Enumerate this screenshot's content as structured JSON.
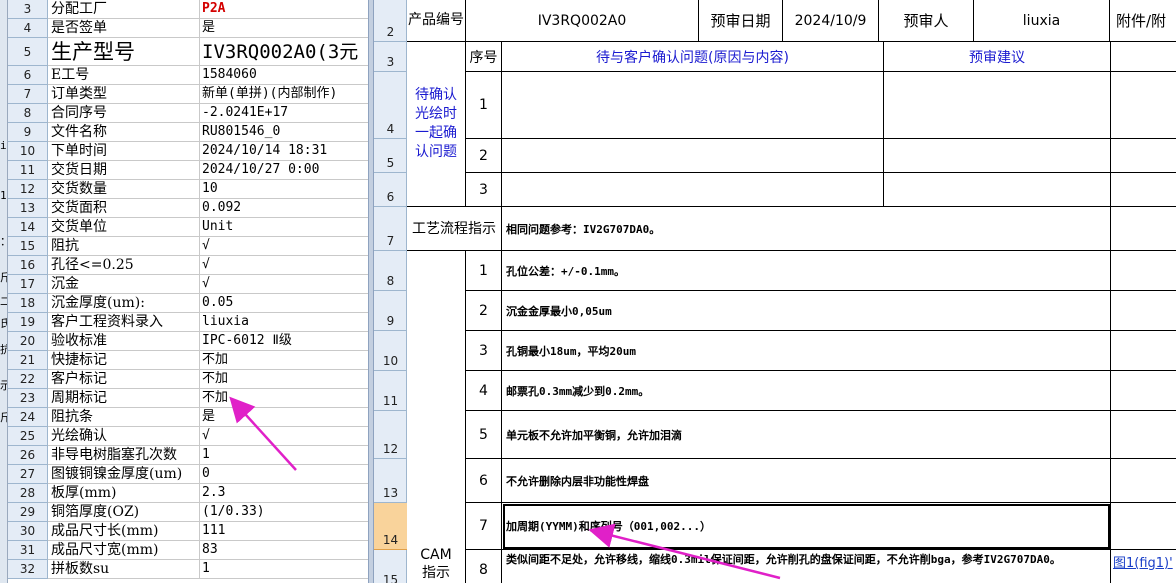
{
  "left_edge_chars": [
    "i",
    "1",
    "：",
    "斤",
    "二",
    "氏",
    "抗",
    "示",
    "斤"
  ],
  "left_sheet": {
    "rows": [
      {
        "num": "3",
        "a": "分配工厂",
        "b": "P2A"
      },
      {
        "num": "4",
        "a": "是否签单",
        "b": "是"
      },
      {
        "num": "5",
        "a": "生产型号",
        "b": "IV3RQ002A0(3元"
      },
      {
        "num": "6",
        "a": "E工号",
        "b": "1584060"
      },
      {
        "num": "7",
        "a": "订单类型",
        "b": "新单(单拼)(内部制作)"
      },
      {
        "num": "8",
        "a": "合同序号",
        "b": "-2.0241E+17"
      },
      {
        "num": "9",
        "a": "文件名称",
        "b": "RU801546_0"
      },
      {
        "num": "10",
        "a": "下单时间",
        "b": "2024/10/14 18:31"
      },
      {
        "num": "11",
        "a": "交货日期",
        "b": "2024/10/27 0:00"
      },
      {
        "num": "12",
        "a": "交货数量",
        "b": "10"
      },
      {
        "num": "13",
        "a": "交货面积",
        "b": "0.092"
      },
      {
        "num": "14",
        "a": "交货单位",
        "b": "Unit"
      },
      {
        "num": "15",
        "a": "阻抗",
        "b": "√"
      },
      {
        "num": "16",
        "a": "孔径<=0.25",
        "b": "√"
      },
      {
        "num": "17",
        "a": "沉金",
        "b": "√"
      },
      {
        "num": "18",
        "a": "沉金厚度(um):",
        "b": "0.05"
      },
      {
        "num": "19",
        "a": "客户工程资料录入",
        "b": "liuxia"
      },
      {
        "num": "20",
        "a": "验收标准",
        "b": "IPC-6012 Ⅱ级"
      },
      {
        "num": "21",
        "a": "快捷标记",
        "b": "不加"
      },
      {
        "num": "22",
        "a": "客户标记",
        "b": "不加"
      },
      {
        "num": "23",
        "a": "周期标记",
        "b": "不加"
      },
      {
        "num": "24",
        "a": "阻抗条",
        "b": "是"
      },
      {
        "num": "25",
        "a": "光绘确认",
        "b": "√"
      },
      {
        "num": "26",
        "a": "非导电树脂塞孔次数",
        "b": "1"
      },
      {
        "num": "27",
        "a": "图镀铜镍金厚度(um)",
        "b": "0"
      },
      {
        "num": "28",
        "a": "板厚(mm)",
        "b": "2.3"
      },
      {
        "num": "29",
        "a": "铜箔厚度(OZ)",
        "b": "(1/0.33)"
      },
      {
        "num": "30",
        "a": "成品尺寸长(mm)",
        "b": "111"
      },
      {
        "num": "31",
        "a": "成品尺寸宽(mm)",
        "b": "83"
      },
      {
        "num": "32",
        "a": "拼板数su",
        "b": "1"
      }
    ]
  },
  "right_row_headers": [
    "2",
    "3",
    "4",
    "5",
    "6",
    "7",
    "8",
    "9",
    "10",
    "11",
    "12",
    "13",
    "14",
    "15"
  ],
  "right_sheet": {
    "product_label": "产品编号",
    "product_value": "IV3RQ002A0",
    "review_date_label": "预审日期",
    "review_date_value": "2024/10/9",
    "reviewer_label": "预审人",
    "reviewer_value": "liuxia",
    "attachment_label": "附件/附",
    "seq_header": "序号",
    "issue_header": "待与客户确认问题(原因与内容)",
    "suggestion_header": "预审建议",
    "confirm_section_label": "待确认光绘时一起确认问题",
    "confirm_nums": [
      "1",
      "2",
      "3"
    ],
    "process_label": "工艺流程指示",
    "process_note": "相同问题参考：IV2G707DA0。",
    "cam_label": "CAM指示",
    "cam_items": [
      {
        "num": "1",
        "text": "孔位公差：+/-0.1mm。"
      },
      {
        "num": "2",
        "text": "沉金金厚最小0,05um"
      },
      {
        "num": "3",
        "text": "孔铜最小18um，平均20um"
      },
      {
        "num": "4",
        "text": "邮票孔0.3mm减少到0.2mm。"
      },
      {
        "num": "5",
        "text": "单元板不允许加平衡铜，允许加泪滴"
      },
      {
        "num": "6",
        "text": "不允许删除内层非功能性焊盘"
      },
      {
        "num": "7",
        "text": "加周期(YYMM)和序列号（001,002...）"
      },
      {
        "num": "8",
        "text": "类似间距不足处，允许移线，缩线0.3mil保证间距，允许削孔的盘保证间距，不允许削bga，参考IV2G707DA0。"
      }
    ],
    "item8_link": "图1(fig1)'"
  },
  "colors": {
    "header_bg": "#e4ecf6",
    "selected_row_header": "#f9d39b",
    "blue_text": "#1a1ad0",
    "red_text": "#d40000",
    "annotation_arrow": "#e020c8"
  }
}
